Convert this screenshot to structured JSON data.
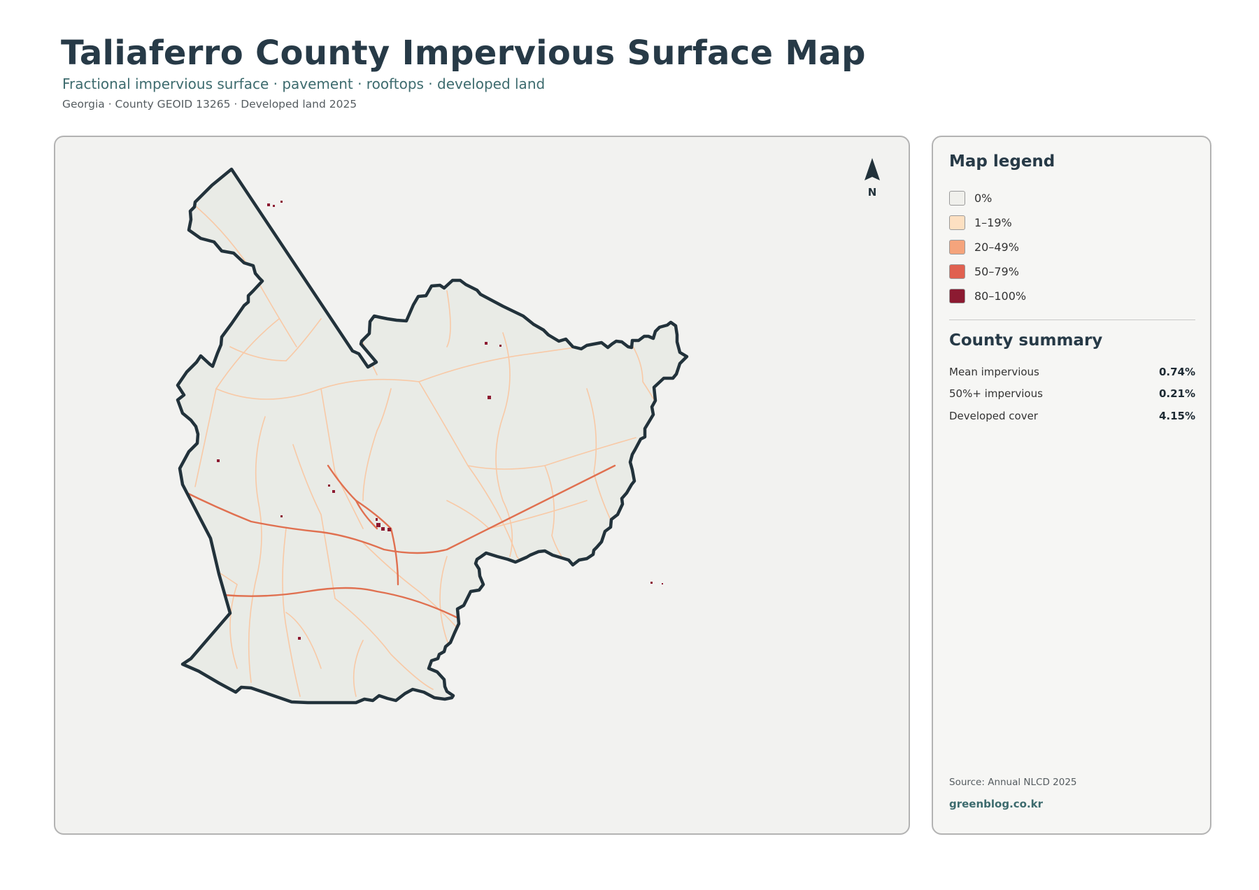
{
  "header": {
    "title": "Taliaferro County Impervious Surface Map",
    "subtitle": "Fractional impervious surface · pavement · rooftops · developed land",
    "meta": "Georgia · County GEOID 13265 · Developed land 2025"
  },
  "map": {
    "north_label": "N",
    "colors": {
      "county_fill": "#e9ebe6",
      "county_outline": "#22323b",
      "background": "#f2f2f0",
      "minor_road": "#f8c9a6",
      "major_road": "#e07050"
    }
  },
  "legend": {
    "title": "Map legend",
    "items": [
      {
        "label": "0%",
        "color": "#f0f0ec"
      },
      {
        "label": "1–19%",
        "color": "#fde0c2"
      },
      {
        "label": "20–49%",
        "color": "#f5a47c"
      },
      {
        "label": "50–79%",
        "color": "#e06150"
      },
      {
        "label": "80–100%",
        "color": "#8c1a31"
      }
    ]
  },
  "summary": {
    "title": "County summary",
    "rows": [
      {
        "label": "Mean impervious",
        "value": "0.74%"
      },
      {
        "label": "50%+ impervious",
        "value": "0.21%"
      },
      {
        "label": "Developed cover",
        "value": "4.15%"
      }
    ]
  },
  "footer": {
    "source": "Source: Annual NLCD 2025",
    "site": "greenblog.co.kr"
  }
}
